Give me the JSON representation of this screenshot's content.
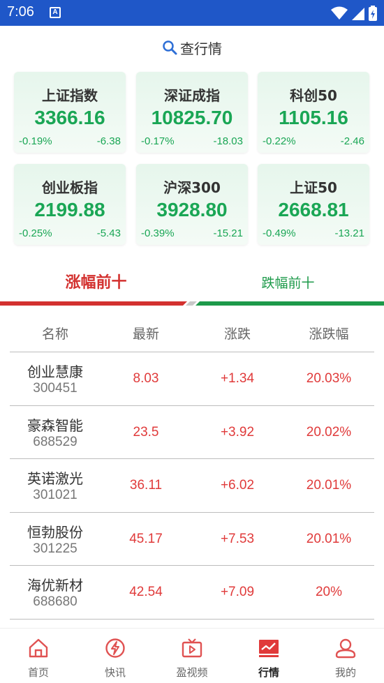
{
  "status": {
    "time": "7:06",
    "badge": "A"
  },
  "search": {
    "label": "查行情"
  },
  "indices": [
    {
      "name": "上证指数",
      "value": "3366.16",
      "pct": "-0.19%",
      "change": "-6.38"
    },
    {
      "name": "深证成指",
      "value": "10825.70",
      "pct": "-0.17%",
      "change": "-18.03"
    },
    {
      "name": "科创50",
      "value": "1105.16",
      "pct": "-0.22%",
      "change": "-2.46"
    },
    {
      "name": "创业板指",
      "value": "2199.88",
      "pct": "-0.25%",
      "change": "-5.43"
    },
    {
      "name": "沪深300",
      "value": "3928.80",
      "pct": "-0.39%",
      "change": "-15.21"
    },
    {
      "name": "上证50",
      "value": "2668.81",
      "pct": "-0.49%",
      "change": "-13.21"
    }
  ],
  "tabs": {
    "up": "涨幅前十",
    "down": "跌幅前十"
  },
  "table": {
    "headers": [
      "名称",
      "最新",
      "涨跌",
      "涨跌幅"
    ],
    "rows": [
      {
        "name": "创业慧康",
        "code": "300451",
        "latest": "8.03",
        "change": "+1.34",
        "pct": "20.03%"
      },
      {
        "name": "豪森智能",
        "code": "688529",
        "latest": "23.5",
        "change": "+3.92",
        "pct": "20.02%"
      },
      {
        "name": "英诺激光",
        "code": "301021",
        "latest": "36.11",
        "change": "+6.02",
        "pct": "20.01%"
      },
      {
        "name": "恒勃股份",
        "code": "301225",
        "latest": "45.17",
        "change": "+7.53",
        "pct": "20.01%"
      },
      {
        "name": "海优新材",
        "code": "688680",
        "latest": "42.54",
        "change": "+7.09",
        "pct": "20%"
      }
    ]
  },
  "nav": [
    {
      "label": "首页",
      "icon": "home-icon"
    },
    {
      "label": "快讯",
      "icon": "flash-news-icon"
    },
    {
      "label": "盈视频",
      "icon": "tv-video-icon"
    },
    {
      "label": "行情",
      "icon": "market-chart-icon"
    },
    {
      "label": "我的",
      "icon": "profile-icon"
    }
  ],
  "colors": {
    "statusbar": "#1f57c8",
    "up_red": "#d3312f",
    "down_green": "#1d9a4a",
    "index_green": "#1aa655",
    "nav_icon": "#e05252"
  }
}
